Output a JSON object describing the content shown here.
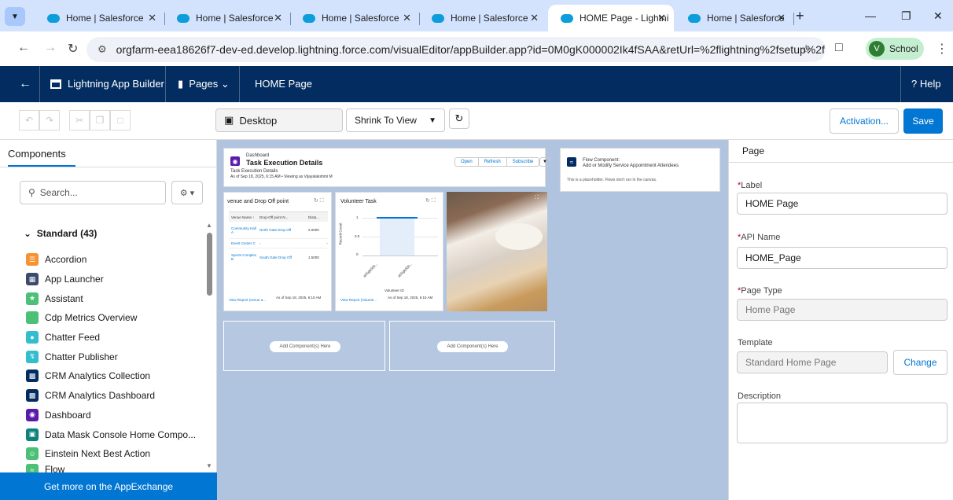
{
  "browser": {
    "tabs": [
      {
        "title": "Home | Salesforce",
        "active": false
      },
      {
        "title": "Home | Salesforce",
        "active": false
      },
      {
        "title": "Home | Salesforce",
        "active": false
      },
      {
        "title": "Home | Salesforce",
        "active": false
      },
      {
        "title": "HOME Page - Lightni",
        "active": true
      },
      {
        "title": "Home | Salesforce",
        "active": false
      }
    ],
    "url": "orgfarm-eea18626f7-dev-ed.develop.lightning.force.com/visualEditor/appBuilder.app?id=0M0gK000002Ik4fSAA&retUrl=%2flightning%2fsetup%2fFlexiPag...",
    "profile_initial": "V",
    "profile_name": "School"
  },
  "header": {
    "app_name": "Lightning App Builder",
    "pages_label": "Pages",
    "page_name": "HOME Page",
    "help_label": "Help"
  },
  "toolbar": {
    "device_label": "Desktop",
    "zoom_label": "Shrink To View",
    "activation_label": "Activation...",
    "save_label": "Save"
  },
  "left_panel": {
    "tab_label": "Components",
    "search_placeholder": "Search...",
    "group_label": "Standard (43)",
    "components": [
      {
        "label": "Accordion",
        "color": "#f59331"
      },
      {
        "label": "App Launcher",
        "color": "#3c4a6b"
      },
      {
        "label": "Assistant",
        "color": "#4bc076"
      },
      {
        "label": "Cdp Metrics Overview",
        "color": "#4bc076"
      },
      {
        "label": "Chatter Feed",
        "color": "#34becd"
      },
      {
        "label": "Chatter Publisher",
        "color": "#34becd"
      },
      {
        "label": "CRM Analytics Collection",
        "color": "#032d60"
      },
      {
        "label": "CRM Analytics Dashboard",
        "color": "#032d60"
      },
      {
        "label": "Dashboard",
        "color": "#5a1ba9"
      },
      {
        "label": "Data Mask Console Home Compo...",
        "color": "#0b827c"
      },
      {
        "label": "Einstein Next Best Action",
        "color": "#4bc076"
      },
      {
        "label": "Flow",
        "color": "#4bc076"
      }
    ],
    "appexchange_label": "Get more on the AppExchange"
  },
  "canvas": {
    "dashboard": {
      "label": "Dashboard",
      "title": "Task Execution Details",
      "subtitle": "Task Execution Details",
      "meta": "As of Sep 18, 2025, 6:15 AM • Viewing as Vijayalakshmi M",
      "buttons": [
        "Open",
        "Refresh",
        "Subscribe"
      ]
    },
    "flow": {
      "title": "Flow Component:",
      "subtitle": "Add or Modify Service Appointment Attendees",
      "note": "This is a placeholder. Flows don't run in the canvas."
    },
    "venue_card": {
      "title": "venue and Drop Off point",
      "columns": [
        "Venue Name ↑",
        "Drop-Off point N...",
        "Dista..."
      ],
      "rows": [
        [
          "Community Hall A",
          "North Gate Drop Off",
          "2.0000"
        ],
        [
          "Event Center C",
          "-",
          "-"
        ],
        [
          "Sports Complex B",
          "South Gate Drop Off",
          "1.5000"
        ]
      ],
      "footer_link": "View Report (venue a...",
      "footer_time": "As of Sep 18, 2025, 6:15 AM"
    },
    "volunteer_card": {
      "title": "Volunteer Task",
      "y_label": "Record Count",
      "x_label": "Volunteer ID",
      "y_ticks": [
        "1",
        "0.5",
        "0"
      ],
      "x_ticks": [
        "a0Sgk000...",
        "a0Sgk000..."
      ],
      "footer_link": "View Report (Volunte...",
      "footer_time": "As of Sep 18, 2025, 6:15 AM"
    },
    "dropzone_label": "Add Component(s) Here"
  },
  "right_panel": {
    "title": "Page",
    "label_label": "Label",
    "label_value": "HOME Page",
    "api_label": "API Name",
    "api_value": "HOME_Page",
    "type_label": "Page Type",
    "type_value": "Home Page",
    "template_label": "Template",
    "template_value": "Standard Home Page",
    "change_label": "Change",
    "description_label": "Description"
  }
}
